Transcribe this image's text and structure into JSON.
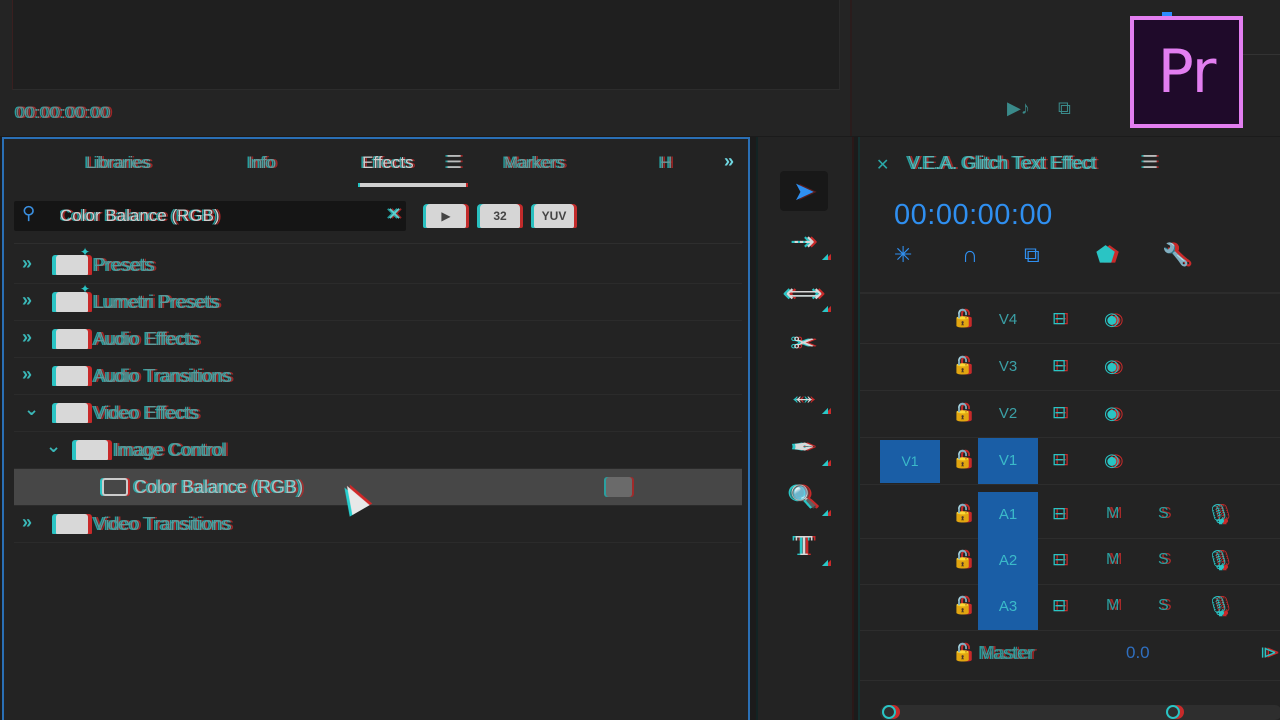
{
  "app": {
    "logo_text": "Pr",
    "logo_color": "#e27ef0"
  },
  "source_monitor": {
    "timecode": "00:00:00:00"
  },
  "effects_panel": {
    "tabs": [
      {
        "label": "Libraries",
        "active": false
      },
      {
        "label": "Info",
        "active": false
      },
      {
        "label": "Effects",
        "active": true
      },
      {
        "label": "Markers",
        "active": false
      },
      {
        "label": "H",
        "active": false
      }
    ],
    "overflow_label": "»",
    "search": {
      "value": "Color Balance (RGB)",
      "placeholder": ""
    },
    "filter_buttons": [
      {
        "name": "accelerated-effects",
        "label": "▶"
      },
      {
        "name": "32-bit-color",
        "label": "32"
      },
      {
        "name": "yuv-effects",
        "label": "YUV"
      }
    ],
    "tree": [
      {
        "label": "Presets",
        "expanded": false,
        "level": 0,
        "type": "preset-folder"
      },
      {
        "label": "Lumetri Presets",
        "expanded": false,
        "level": 0,
        "type": "preset-folder"
      },
      {
        "label": "Audio Effects",
        "expanded": false,
        "level": 0,
        "type": "folder"
      },
      {
        "label": "Audio Transitions",
        "expanded": false,
        "level": 0,
        "type": "folder"
      },
      {
        "label": "Video Effects",
        "expanded": true,
        "level": 0,
        "type": "folder"
      },
      {
        "label": "Image Control",
        "expanded": true,
        "level": 1,
        "type": "folder"
      },
      {
        "label": "Color Balance (RGB)",
        "level": 2,
        "type": "effect",
        "selected": true
      },
      {
        "label": "Video Transitions",
        "expanded": false,
        "level": 0,
        "type": "folder"
      }
    ]
  },
  "tools": [
    {
      "name": "selection-tool",
      "glyph": "➤",
      "active": true
    },
    {
      "name": "track-select-tool",
      "glyph": "⇢"
    },
    {
      "name": "ripple-edit-tool",
      "glyph": "⟺"
    },
    {
      "name": "razor-tool",
      "glyph": "✂"
    },
    {
      "name": "slip-tool",
      "glyph": "↔"
    },
    {
      "name": "pen-tool",
      "glyph": "✒"
    },
    {
      "name": "zoom-tool",
      "glyph": "🔍"
    },
    {
      "name": "type-tool",
      "glyph": "T"
    }
  ],
  "timeline": {
    "title": "V.E.A. Glitch Text Effect",
    "timecode": "00:00:00:00",
    "video_tracks": [
      {
        "name": "V4",
        "source": ""
      },
      {
        "name": "V3",
        "source": ""
      },
      {
        "name": "V2",
        "source": ""
      },
      {
        "name": "V1",
        "source": "V1"
      }
    ],
    "audio_tracks": [
      {
        "name": "A1",
        "mute": "M",
        "solo": "S"
      },
      {
        "name": "A2",
        "mute": "M",
        "solo": "S"
      },
      {
        "name": "A3",
        "mute": "M",
        "solo": "S"
      }
    ],
    "master": {
      "label": "Master",
      "volume": "0.0"
    },
    "accent_color": "#2f8ff0"
  }
}
